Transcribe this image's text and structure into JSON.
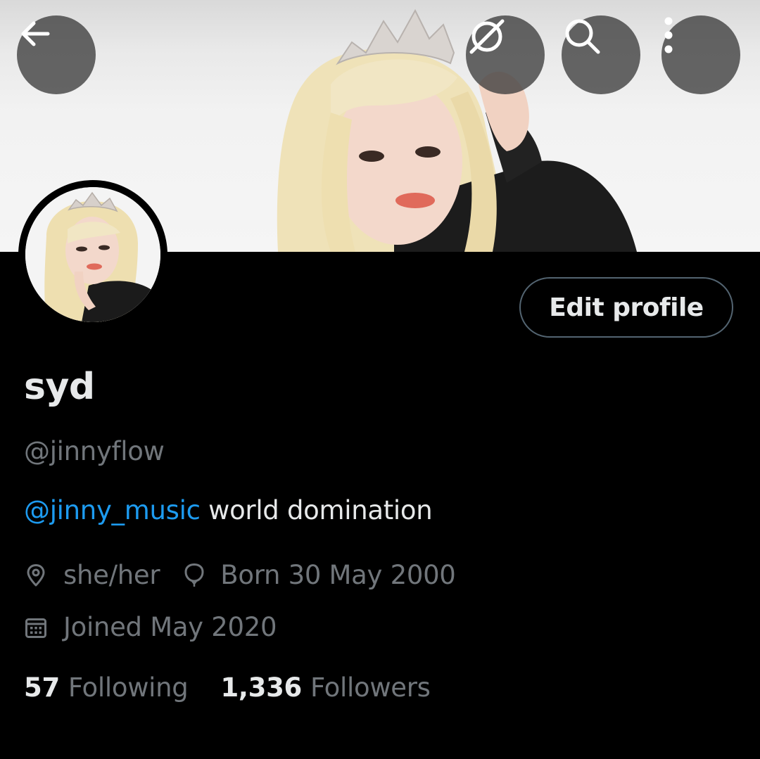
{
  "profile": {
    "display_name": "syd",
    "handle": "@jinnyflow",
    "bio_mention": "@jinny_music",
    "bio_text": " world domination",
    "pronouns": "she/her",
    "birthday": "Born 30 May 2000",
    "joined": "Joined May 2020"
  },
  "stats": {
    "following_count": "57",
    "following_label": "Following",
    "followers_count": "1,336",
    "followers_label": "Followers"
  },
  "actions": {
    "edit_profile_label": "Edit profile"
  },
  "icons": {
    "back": "arrow-left-icon",
    "grok": "grok-icon",
    "search": "search-icon",
    "more": "more-vertical-icon",
    "location": "location-pin-icon",
    "birthday": "balloon-icon",
    "joined": "calendar-icon"
  },
  "colors": {
    "background": "#000000",
    "text_primary": "#e7e9ea",
    "text_secondary": "#71767b",
    "accent": "#1d9bf0",
    "button_border": "#536471"
  }
}
